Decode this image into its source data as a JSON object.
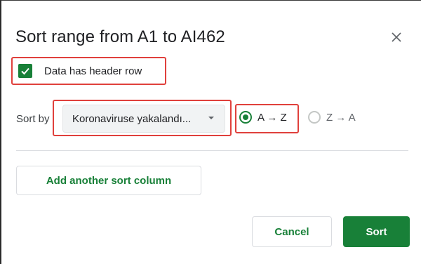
{
  "dialog": {
    "title": "Sort range from A1 to AI462",
    "close_icon": "close-icon"
  },
  "header_row": {
    "label": "Data has header row",
    "checked": true
  },
  "sort_by": {
    "label": "Sort by",
    "selected_column": "Koronaviruse yakalandı...",
    "options": [
      {
        "label": "A → Z",
        "selected": true
      },
      {
        "label": "Z → A",
        "selected": false
      }
    ]
  },
  "actions": {
    "add_column": "Add another sort column",
    "cancel": "Cancel",
    "sort": "Sort"
  },
  "colors": {
    "accent": "#188038",
    "highlight": "#e0403c"
  }
}
